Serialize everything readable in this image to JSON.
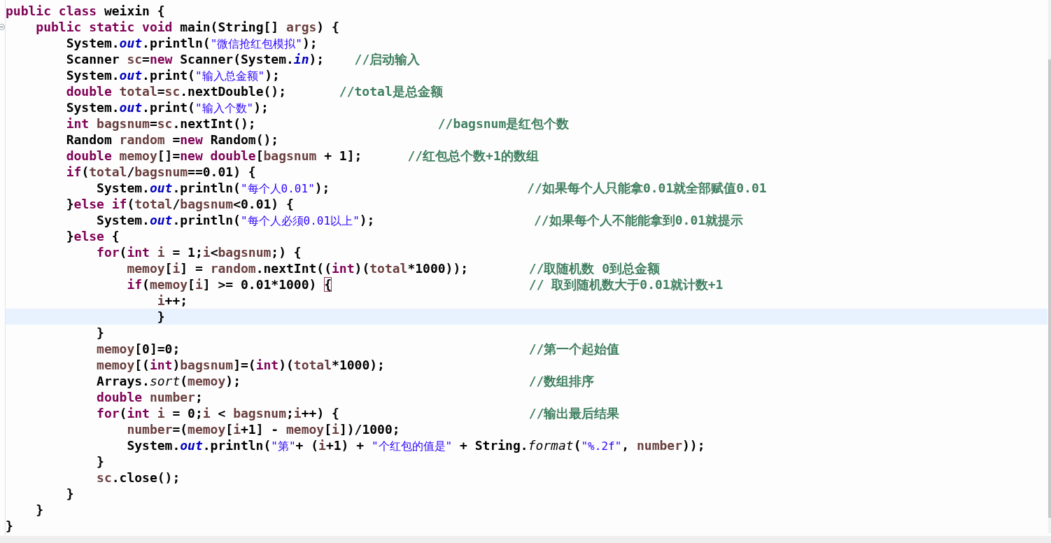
{
  "editor": {
    "lines": [
      {
        "code": [
          {
            "kind": "kw",
            "text": "public"
          },
          {
            "kind": "kw",
            "text": " class"
          },
          {
            "kind": "plain",
            "text": " weixin {"
          }
        ]
      },
      {
        "folded": false,
        "code": [
          {
            "kind": "kw",
            "text": "    public"
          },
          {
            "kind": "kw",
            "text": " static"
          },
          {
            "kind": "kw",
            "text": " void"
          },
          {
            "kind": "plain",
            "text": " main(String[] "
          },
          {
            "kind": "var",
            "text": "args"
          },
          {
            "kind": "plain",
            "text": ") {"
          }
        ]
      },
      {
        "code": [
          {
            "kind": "plain",
            "text": "        System."
          },
          {
            "kind": "field",
            "text": "out"
          },
          {
            "kind": "plain",
            "text": ".println("
          },
          {
            "kind": "str",
            "text": "\"微信抢红包模拟\""
          },
          {
            "kind": "plain",
            "text": ");"
          }
        ]
      },
      {
        "code": [
          {
            "kind": "plain",
            "text": "        Scanner "
          },
          {
            "kind": "var",
            "text": "sc"
          },
          {
            "kind": "plain",
            "text": "="
          },
          {
            "kind": "kw",
            "text": "new"
          },
          {
            "kind": "plain",
            "text": " Scanner(System."
          },
          {
            "kind": "field",
            "text": "in"
          },
          {
            "kind": "plain",
            "text": ");"
          }
        ],
        "comment": "    //启动输入"
      },
      {
        "code": [
          {
            "kind": "plain",
            "text": "        System."
          },
          {
            "kind": "field",
            "text": "out"
          },
          {
            "kind": "plain",
            "text": ".print("
          },
          {
            "kind": "str",
            "text": "\"输入总金额\""
          },
          {
            "kind": "plain",
            "text": ");"
          }
        ]
      },
      {
        "code": [
          {
            "kind": "kw",
            "text": "        double"
          },
          {
            "kind": "var",
            "text": " total"
          },
          {
            "kind": "plain",
            "text": "="
          },
          {
            "kind": "var",
            "text": "sc"
          },
          {
            "kind": "plain",
            "text": ".nextDouble();"
          }
        ],
        "comment": "       //total是总金额"
      },
      {
        "code": [
          {
            "kind": "plain",
            "text": "        System."
          },
          {
            "kind": "field",
            "text": "out"
          },
          {
            "kind": "plain",
            "text": ".print("
          },
          {
            "kind": "str",
            "text": "\"输入个数\""
          },
          {
            "kind": "plain",
            "text": ");"
          }
        ]
      },
      {
        "code": [
          {
            "kind": "kw",
            "text": "        int"
          },
          {
            "kind": "var",
            "text": " bagsnum"
          },
          {
            "kind": "plain",
            "text": "="
          },
          {
            "kind": "var",
            "text": "sc"
          },
          {
            "kind": "plain",
            "text": ".nextInt();"
          }
        ],
        "comment": "                        //bagsnum是红包个数"
      },
      {
        "code": [
          {
            "kind": "plain",
            "text": "        Random "
          },
          {
            "kind": "var",
            "text": "random"
          },
          {
            "kind": "plain",
            "text": " ="
          },
          {
            "kind": "kw",
            "text": "new"
          },
          {
            "kind": "plain",
            "text": " Random();"
          }
        ]
      },
      {
        "code": [
          {
            "kind": "kw",
            "text": "        double"
          },
          {
            "kind": "var",
            "text": " memoy"
          },
          {
            "kind": "plain",
            "text": "[]="
          },
          {
            "kind": "kw",
            "text": "new"
          },
          {
            "kind": "kw",
            "text": " double"
          },
          {
            "kind": "plain",
            "text": "["
          },
          {
            "kind": "var",
            "text": "bagsnum"
          },
          {
            "kind": "plain",
            "text": " + 1];"
          }
        ],
        "comment": "      //红包总个数+1的数组"
      },
      {
        "code": [
          {
            "kind": "kw",
            "text": "        if"
          },
          {
            "kind": "plain",
            "text": "("
          },
          {
            "kind": "var",
            "text": "total"
          },
          {
            "kind": "plain",
            "text": "/"
          },
          {
            "kind": "var",
            "text": "bagsnum"
          },
          {
            "kind": "plain",
            "text": "==0.01) {"
          }
        ]
      },
      {
        "code": [
          {
            "kind": "plain",
            "text": "            System."
          },
          {
            "kind": "field",
            "text": "out"
          },
          {
            "kind": "plain",
            "text": ".println("
          },
          {
            "kind": "str",
            "text": "\"每个人0.01\""
          },
          {
            "kind": "plain",
            "text": ");"
          }
        ],
        "comment": "                          //如果每个人只能拿0.01就全部赋值0.01"
      },
      {
        "code": [
          {
            "kind": "plain",
            "text": "        }"
          },
          {
            "kind": "kw",
            "text": "else"
          },
          {
            "kind": "kw",
            "text": " if"
          },
          {
            "kind": "plain",
            "text": "("
          },
          {
            "kind": "var",
            "text": "total"
          },
          {
            "kind": "plain",
            "text": "/"
          },
          {
            "kind": "var",
            "text": "bagsnum"
          },
          {
            "kind": "plain",
            "text": "<0.01) {"
          }
        ]
      },
      {
        "code": [
          {
            "kind": "plain",
            "text": "            System."
          },
          {
            "kind": "field",
            "text": "out"
          },
          {
            "kind": "plain",
            "text": ".println("
          },
          {
            "kind": "str",
            "text": "\"每个人必须0.01以上\""
          },
          {
            "kind": "plain",
            "text": ");"
          }
        ],
        "comment": "                     //如果每个人不能能拿到0.01就提示"
      },
      {
        "code": [
          {
            "kind": "plain",
            "text": "        }"
          },
          {
            "kind": "kw",
            "text": "else"
          },
          {
            "kind": "plain",
            "text": " {"
          }
        ]
      },
      {
        "code": [
          {
            "kind": "kw",
            "text": "            for"
          },
          {
            "kind": "plain",
            "text": "("
          },
          {
            "kind": "kw",
            "text": "int"
          },
          {
            "kind": "var",
            "text": " i"
          },
          {
            "kind": "plain",
            "text": " = 1;"
          },
          {
            "kind": "var",
            "text": "i"
          },
          {
            "kind": "plain",
            "text": "<"
          },
          {
            "kind": "var",
            "text": "bagsnum"
          },
          {
            "kind": "plain",
            "text": ";) {"
          }
        ]
      },
      {
        "code": [
          {
            "kind": "var",
            "text": "                memoy"
          },
          {
            "kind": "plain",
            "text": "["
          },
          {
            "kind": "var",
            "text": "i"
          },
          {
            "kind": "plain",
            "text": "] = "
          },
          {
            "kind": "var",
            "text": "random"
          },
          {
            "kind": "plain",
            "text": ".nextInt(("
          },
          {
            "kind": "kw",
            "text": "int"
          },
          {
            "kind": "plain",
            "text": ")("
          },
          {
            "kind": "var",
            "text": "total"
          },
          {
            "kind": "plain",
            "text": "*1000));"
          }
        ],
        "comment": "        //取随机数 0到总金额"
      },
      {
        "code": [
          {
            "kind": "kw",
            "text": "                if"
          },
          {
            "kind": "plain",
            "text": "("
          },
          {
            "kind": "var",
            "text": "memoy"
          },
          {
            "kind": "plain",
            "text": "["
          },
          {
            "kind": "var",
            "text": "i"
          },
          {
            "kind": "plain",
            "text": "] >= 0.01*1000) "
          },
          {
            "kind": "match",
            "text": "{"
          }
        ],
        "comment": "                          // 取到随机数大于0.01就计数+1"
      },
      {
        "code": [
          {
            "kind": "var",
            "text": "                    i"
          },
          {
            "kind": "plain",
            "text": "++;"
          }
        ]
      },
      {
        "current": true,
        "code": [
          {
            "kind": "plain",
            "text": "                    }"
          }
        ]
      },
      {
        "code": [
          {
            "kind": "plain",
            "text": "            }"
          }
        ]
      },
      {
        "code": [
          {
            "kind": "var",
            "text": "            memoy"
          },
          {
            "kind": "plain",
            "text": "[0]=0;"
          }
        ],
        "comment": "                                              //第一个起始值"
      },
      {
        "code": [
          {
            "kind": "var",
            "text": "            memoy"
          },
          {
            "kind": "plain",
            "text": "[("
          },
          {
            "kind": "kw",
            "text": "int"
          },
          {
            "kind": "plain",
            "text": ")"
          },
          {
            "kind": "var",
            "text": "bagsnum"
          },
          {
            "kind": "plain",
            "text": "]=("
          },
          {
            "kind": "kw",
            "text": "int"
          },
          {
            "kind": "plain",
            "text": ")("
          },
          {
            "kind": "var",
            "text": "total"
          },
          {
            "kind": "plain",
            "text": "*1000);"
          }
        ]
      },
      {
        "code": [
          {
            "kind": "plain",
            "text": "            Arrays."
          },
          {
            "kind": "smethod",
            "text": "sort"
          },
          {
            "kind": "plain",
            "text": "("
          },
          {
            "kind": "var",
            "text": "memoy"
          },
          {
            "kind": "plain",
            "text": ");"
          }
        ],
        "comment": "                                      //数组排序"
      },
      {
        "code": [
          {
            "kind": "kw",
            "text": "            double"
          },
          {
            "kind": "var",
            "text": " number"
          },
          {
            "kind": "plain",
            "text": ";"
          }
        ]
      },
      {
        "code": [
          {
            "kind": "kw",
            "text": "            for"
          },
          {
            "kind": "plain",
            "text": "("
          },
          {
            "kind": "kw",
            "text": "int"
          },
          {
            "kind": "var",
            "text": " i"
          },
          {
            "kind": "plain",
            "text": " = 0;"
          },
          {
            "kind": "var",
            "text": "i"
          },
          {
            "kind": "plain",
            "text": " < "
          },
          {
            "kind": "var",
            "text": "bagsnum"
          },
          {
            "kind": "plain",
            "text": ";"
          },
          {
            "kind": "var",
            "text": "i"
          },
          {
            "kind": "plain",
            "text": "++) {"
          }
        ],
        "comment": "                         //输出最后结果"
      },
      {
        "code": [
          {
            "kind": "var",
            "text": "                number"
          },
          {
            "kind": "plain",
            "text": "=("
          },
          {
            "kind": "var",
            "text": "memoy"
          },
          {
            "kind": "plain",
            "text": "["
          },
          {
            "kind": "var",
            "text": "i"
          },
          {
            "kind": "plain",
            "text": "+1] - "
          },
          {
            "kind": "var",
            "text": "memoy"
          },
          {
            "kind": "plain",
            "text": "["
          },
          {
            "kind": "var",
            "text": "i"
          },
          {
            "kind": "plain",
            "text": "])/1000;"
          }
        ]
      },
      {
        "code": [
          {
            "kind": "plain",
            "text": "                System."
          },
          {
            "kind": "field",
            "text": "out"
          },
          {
            "kind": "plain",
            "text": ".println("
          },
          {
            "kind": "str",
            "text": "\"第\""
          },
          {
            "kind": "plain",
            "text": "+ ("
          },
          {
            "kind": "var",
            "text": "i"
          },
          {
            "kind": "plain",
            "text": "+1) + "
          },
          {
            "kind": "str",
            "text": "\"个红包的值是\""
          },
          {
            "kind": "plain",
            "text": " + String."
          },
          {
            "kind": "smethod",
            "text": "format"
          },
          {
            "kind": "plain",
            "text": "("
          },
          {
            "kind": "str",
            "text": "\"%.2f\""
          },
          {
            "kind": "plain",
            "text": ", "
          },
          {
            "kind": "var",
            "text": "number"
          },
          {
            "kind": "plain",
            "text": "));"
          }
        ]
      },
      {
        "code": [
          {
            "kind": "plain",
            "text": "            }"
          }
        ]
      },
      {
        "code": [
          {
            "kind": "var",
            "text": "            sc"
          },
          {
            "kind": "plain",
            "text": ".close();"
          }
        ]
      },
      {
        "code": [
          {
            "kind": "plain",
            "text": "        }"
          }
        ]
      },
      {
        "code": [
          {
            "kind": "plain",
            "text": "    }"
          }
        ]
      },
      {
        "code": [
          {
            "kind": "plain",
            "text": "}"
          }
        ]
      }
    ]
  }
}
